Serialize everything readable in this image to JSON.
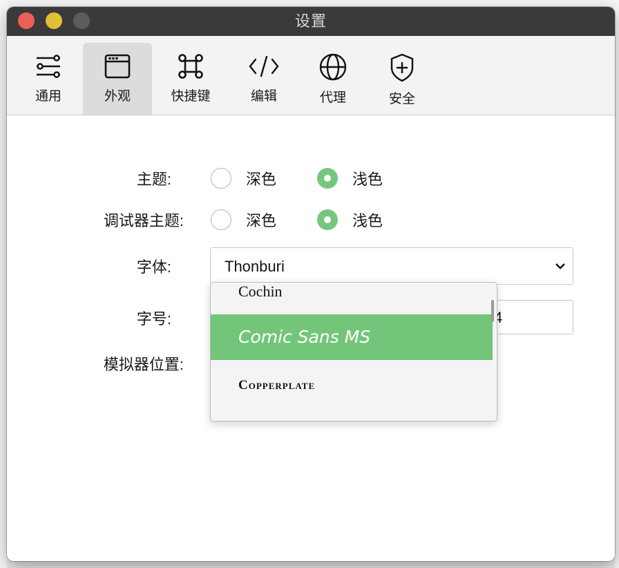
{
  "window": {
    "title": "设置"
  },
  "toolbar": {
    "items": [
      {
        "label": "通用",
        "icon": "sliders-icon",
        "active": false
      },
      {
        "label": "外观",
        "icon": "window-icon",
        "active": true
      },
      {
        "label": "快捷键",
        "icon": "command-key-icon",
        "active": false
      },
      {
        "label": "编辑",
        "icon": "code-icon",
        "active": false
      },
      {
        "label": "代理",
        "icon": "globe-icon",
        "active": false
      },
      {
        "label": "安全",
        "icon": "shield-plus-icon",
        "active": false
      }
    ]
  },
  "form": {
    "theme": {
      "label": "主题:",
      "option_dark": "深色",
      "option_light": "浅色",
      "selected": "浅色"
    },
    "debugger_theme": {
      "label": "调试器主题:",
      "option_dark": "深色",
      "option_light": "浅色",
      "selected": "浅色"
    },
    "font": {
      "label": "字体:",
      "value": "Thonburi",
      "dropdown_options": [
        "Cochin",
        "Comic Sans MS",
        "Copperplate"
      ],
      "highlighted": "Comic Sans MS"
    },
    "font_size": {
      "label": "字号:",
      "value_visible": "4"
    },
    "simulator_position": {
      "label": "模拟器位置:"
    }
  },
  "colors": {
    "accent": "#73c57a",
    "titlebar": "#3a3a3c",
    "close": "#ec5f57",
    "minimize": "#e2c033",
    "maximize": "#5c5c5f"
  }
}
